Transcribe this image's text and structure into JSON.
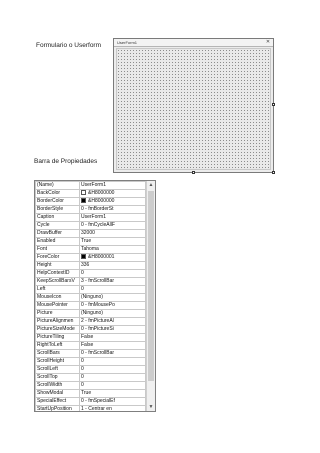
{
  "captions": {
    "form_caption": "Formulario o Userform",
    "props_caption": "Barra de Propiedades"
  },
  "form_window": {
    "title": "UserForm1",
    "close_glyph": "✕"
  },
  "properties": [
    {
      "name": "(Name)",
      "value": "UserForm1"
    },
    {
      "name": "BackColor",
      "value": "&H8000000",
      "swatch": "#ffffff"
    },
    {
      "name": "BorderColor",
      "value": "&H8000000",
      "swatch": "#000000"
    },
    {
      "name": "BorderStyle",
      "value": "0 - fmBorderSt"
    },
    {
      "name": "Caption",
      "value": "UserForm1"
    },
    {
      "name": "Cycle",
      "value": "0 - fmCycleAllF"
    },
    {
      "name": "DrawBuffer",
      "value": "32000"
    },
    {
      "name": "Enabled",
      "value": "True"
    },
    {
      "name": "Font",
      "value": "Tahoma"
    },
    {
      "name": "ForeColor",
      "value": "&H8000001",
      "swatch": "#000000"
    },
    {
      "name": "Height",
      "value": "336"
    },
    {
      "name": "HelpContextID",
      "value": "0"
    },
    {
      "name": "KeepScrollBarsV",
      "value": "3 - fmScrollBar"
    },
    {
      "name": "Left",
      "value": "0"
    },
    {
      "name": "MouseIcon",
      "value": "(Ninguno)"
    },
    {
      "name": "MousePointer",
      "value": "0 - fmMousePo"
    },
    {
      "name": "Picture",
      "value": "(Ninguno)"
    },
    {
      "name": "PictureAlignmen",
      "value": "2 - fmPictureAl"
    },
    {
      "name": "PictureSizeMode",
      "value": "0 - fmPictureSi"
    },
    {
      "name": "PictureTiling",
      "value": "False"
    },
    {
      "name": "RightToLeft",
      "value": "False"
    },
    {
      "name": "ScrollBars",
      "value": "0 - fmScrollBar"
    },
    {
      "name": "ScrollHeight",
      "value": "0"
    },
    {
      "name": "ScrollLeft",
      "value": "0"
    },
    {
      "name": "ScrollTop",
      "value": "0"
    },
    {
      "name": "ScrollWidth",
      "value": "0"
    },
    {
      "name": "ShowModal",
      "value": "True"
    },
    {
      "name": "SpecialEffect",
      "value": "0 - fmSpecialEf"
    },
    {
      "name": "StartUpPosition",
      "value": "1 - Centrar en"
    },
    {
      "name": "Tag",
      "value": ""
    },
    {
      "name": "Top",
      "value": "0"
    },
    {
      "name": "WhatsThisButton",
      "value": "False"
    },
    {
      "name": "WhatsThisHelp",
      "value": "False"
    },
    {
      "name": "Width",
      "value": "411.75",
      "selected": true
    },
    {
      "name": "Zoom",
      "value": "100"
    }
  ],
  "colors": {
    "selection": "#3366cc",
    "grid_line": "#c9c9c9"
  }
}
